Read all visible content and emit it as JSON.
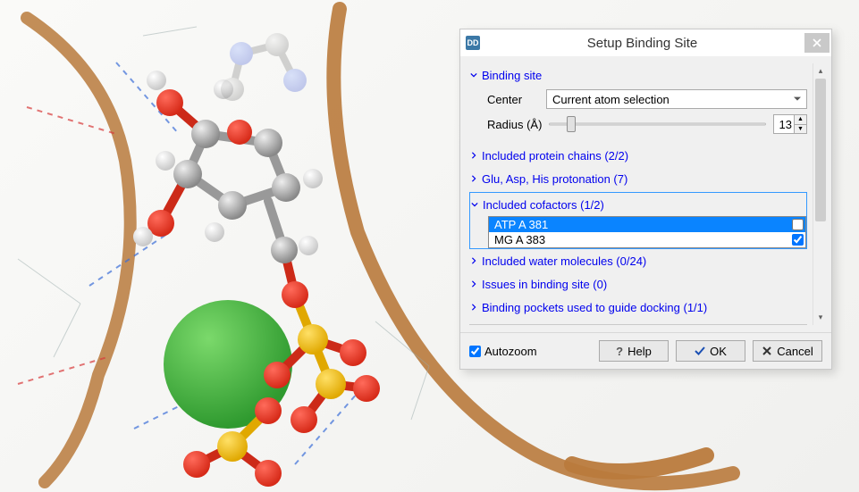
{
  "dialog": {
    "icon_text": "DD",
    "title": "Setup Binding Site",
    "sections": {
      "binding_site": {
        "label": "Binding site",
        "center_label": "Center",
        "center_value": "Current atom selection",
        "radius_label": "Radius (Å)",
        "radius_value": "13"
      },
      "protein_chains": "Included protein chains (2/2)",
      "protonation": "Glu, Asp, His protonation (7)",
      "cofactors": {
        "label": "Included cofactors (1/2)",
        "items": [
          {
            "label": "ATP A 381",
            "checked": false,
            "selected": true
          },
          {
            "label": "MG A 383",
            "checked": true,
            "selected": false
          }
        ]
      },
      "water": "Included water molecules (0/24)",
      "issues": "Issues in binding site (0)",
      "pockets": "Binding pockets used to guide docking (1/1)"
    },
    "footer": {
      "autozoom": "Autozoom",
      "help": "Help",
      "ok": "OK",
      "cancel": "Cancel"
    }
  }
}
